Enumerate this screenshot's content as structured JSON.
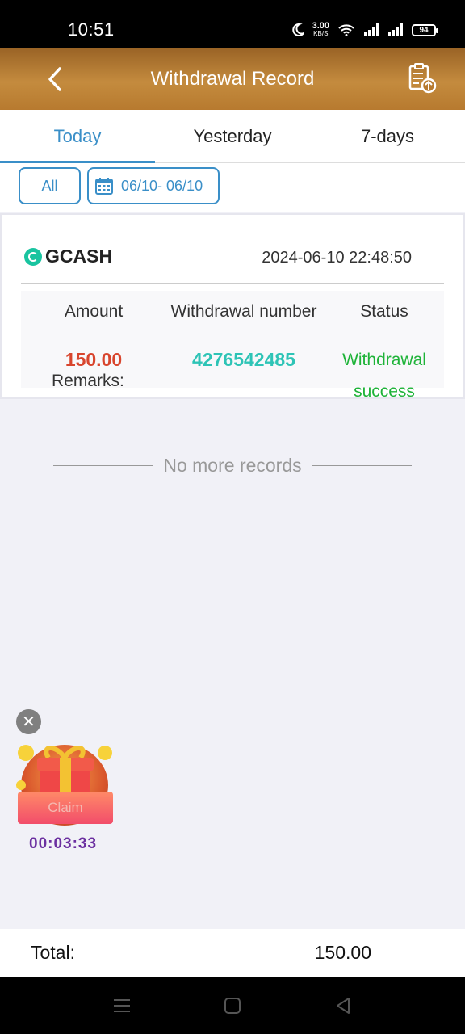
{
  "status_bar": {
    "time": "10:51",
    "net_speed": "3.00",
    "net_unit": "KB/S",
    "battery": "94",
    "icons": [
      "moon-icon",
      "wifi-icon",
      "signal-icon",
      "signal-icon",
      "battery-icon"
    ]
  },
  "header": {
    "title": "Withdrawal Record",
    "back_icon": "chevron-left-icon",
    "record_icon": "clipboard-upload-icon"
  },
  "tabs": [
    {
      "label": "Today",
      "active": true
    },
    {
      "label": "Yesterday",
      "active": false
    },
    {
      "label": "7-days",
      "active": false
    }
  ],
  "filter": {
    "type_label": "All",
    "date_range": "06/10- 06/10",
    "calendar_icon": "calendar-icon"
  },
  "record": {
    "channel": "GCASH",
    "datetime": "2024-06-10 22:48:50",
    "headers": {
      "amount": "Amount",
      "number": "Withdrawal number",
      "status": "Status"
    },
    "amount": "150.00",
    "number": "4276542485",
    "status_line1": "Withdrawal",
    "status_line2": "success",
    "remarks_label": "Remarks:"
  },
  "list_end_text": "No more records",
  "claim_widget": {
    "label": "Claim",
    "timer": "00:03:33",
    "close_icon": "close-icon",
    "gift_icon": "gift-icon"
  },
  "total": {
    "label": "Total:",
    "value": "150.00"
  },
  "colors": {
    "accent": "#3a8fc8",
    "header_brown": "#b77a2f",
    "amount_red": "#d8452d",
    "number_teal": "#2ec4b6",
    "success_green": "#1eb338"
  }
}
